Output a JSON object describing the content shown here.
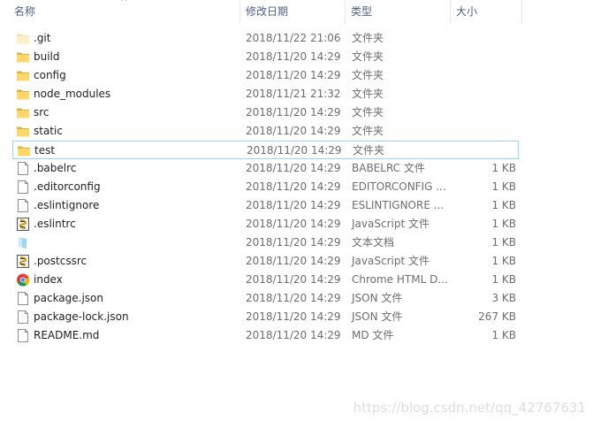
{
  "columns": {
    "name": "名称",
    "modified": "修改日期",
    "type": "类型",
    "size": "大小"
  },
  "files": [
    {
      "name": ".git",
      "date": "2018/11/22 21:06",
      "type": "文件夹",
      "size": "",
      "icon": "folder-light-icon"
    },
    {
      "name": "build",
      "date": "2018/11/20 14:29",
      "type": "文件夹",
      "size": "",
      "icon": "folder-icon"
    },
    {
      "name": "config",
      "date": "2018/11/20 14:29",
      "type": "文件夹",
      "size": "",
      "icon": "folder-icon"
    },
    {
      "name": "node_modules",
      "date": "2018/11/21 21:32",
      "type": "文件夹",
      "size": "",
      "icon": "folder-icon"
    },
    {
      "name": "src",
      "date": "2018/11/20 14:29",
      "type": "文件夹",
      "size": "",
      "icon": "folder-icon"
    },
    {
      "name": "static",
      "date": "2018/11/20 14:29",
      "type": "文件夹",
      "size": "",
      "icon": "folder-icon"
    },
    {
      "name": "test",
      "date": "2018/11/20 14:29",
      "type": "文件夹",
      "size": "",
      "icon": "folder-icon",
      "selected": true
    },
    {
      "name": ".babelrc",
      "date": "2018/11/20 14:29",
      "type": "BABELRC 文件",
      "size": "1 KB",
      "icon": "file-icon"
    },
    {
      "name": ".editorconfig",
      "date": "2018/11/20 14:29",
      "type": "EDITORCONFIG ...",
      "size": "1 KB",
      "icon": "file-icon"
    },
    {
      "name": ".eslintignore",
      "date": "2018/11/20 14:29",
      "type": "ESLINTIGNORE ...",
      "size": "1 KB",
      "icon": "file-icon"
    },
    {
      "name": ".eslintrc",
      "date": "2018/11/20 14:29",
      "type": "JavaScript 文件",
      "size": "1 KB",
      "icon": "script-icon"
    },
    {
      "name": "",
      "date": "2018/11/20 14:29",
      "type": "文本文档",
      "size": "1 KB",
      "icon": "text-document-icon"
    },
    {
      "name": ".postcssrc",
      "date": "2018/11/20 14:29",
      "type": "JavaScript 文件",
      "size": "1 KB",
      "icon": "script-icon"
    },
    {
      "name": "index",
      "date": "2018/11/20 14:29",
      "type": "Chrome HTML D...",
      "size": "1 KB",
      "icon": "chrome-icon"
    },
    {
      "name": "package.json",
      "date": "2018/11/20 14:29",
      "type": "JSON 文件",
      "size": "3 KB",
      "icon": "file-icon"
    },
    {
      "name": "package-lock.json",
      "date": "2018/11/20 14:29",
      "type": "JSON 文件",
      "size": "267 KB",
      "icon": "file-icon"
    },
    {
      "name": "README.md",
      "date": "2018/11/20 14:29",
      "type": "MD 文件",
      "size": "1 KB",
      "icon": "file-icon"
    }
  ],
  "watermark": "https://blog.csdn.net/qq_42767631"
}
